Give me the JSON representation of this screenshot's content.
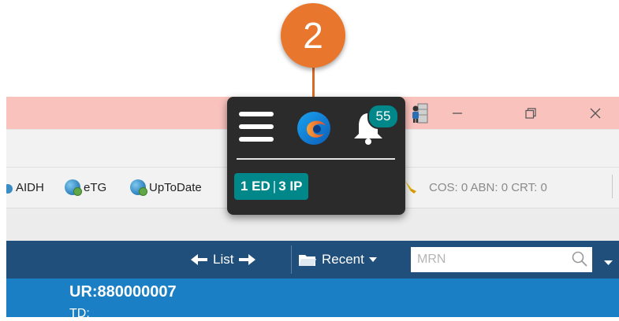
{
  "callout": {
    "number": "2",
    "color": "#e8772d"
  },
  "window": {
    "title_bar_color": "#f9c2bd",
    "minimize_icon": "minimize-icon",
    "restore_icon": "restore-icon",
    "close_icon": "close-icon"
  },
  "toolbar": {
    "links": [
      {
        "label": "AIDH",
        "icon": "link-icon"
      },
      {
        "label": "eTG",
        "icon": "globe-icon"
      },
      {
        "label": "UpToDate",
        "icon": "globe-icon"
      }
    ],
    "counters": "COS: 0  ABN: 0  CRT: 0"
  },
  "widget": {
    "menu_icon": "hamburger-menu-icon",
    "app_icon": "app-logo-icon",
    "bell_icon": "bell-icon",
    "notification_count": "55",
    "badge": {
      "ed": "1 ED",
      "separator": "|",
      "ip": "3 IP",
      "color": "#00878a"
    }
  },
  "navbar": {
    "list_label": "List",
    "recent_label": "Recent",
    "mrn_placeholder": "MRN",
    "color": "#1f4f7a"
  },
  "patient": {
    "ur": "UR:880000007",
    "td": "TD:",
    "banner_color": "#1a7fc4"
  }
}
